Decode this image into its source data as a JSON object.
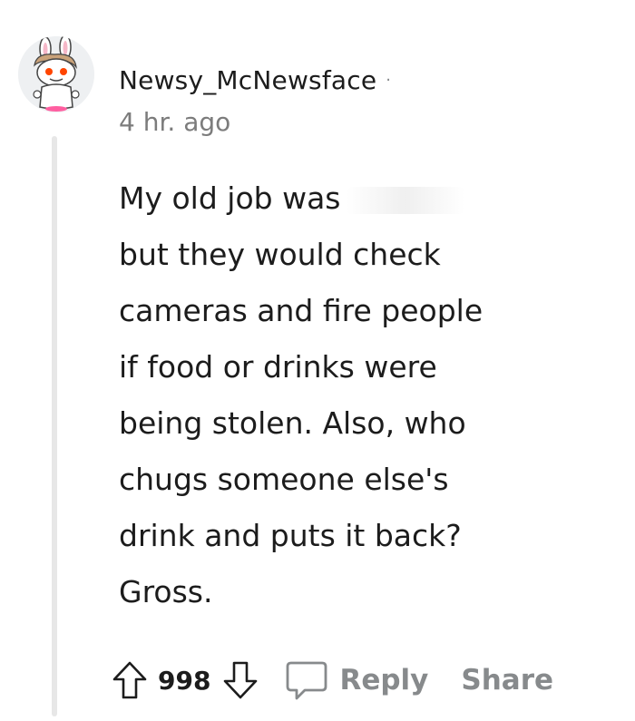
{
  "comment": {
    "author": "Newsy_McNewsface",
    "separator": "·",
    "timestamp": "4 hr. ago",
    "body_lines": [
      "My old job was",
      "but they would check",
      "cameras and fire people",
      "if food or drinks were",
      "being stolen. Also, who",
      "chugs someone else's",
      "drink and puts it back?",
      "Gross."
    ]
  },
  "actions": {
    "score": "998",
    "reply_label": "Reply",
    "share_label": "Share"
  },
  "colors": {
    "text": "#1c1c1c",
    "meta": "#7c7c7c",
    "action_gray": "#878a8c",
    "thread_line": "#e7e7e7",
    "avatar_bg": "#eef0f2",
    "snoo_eye": "#ff4500"
  },
  "icons": {
    "avatar": "snoo-avatar",
    "upvote": "upvote-arrow-icon",
    "downvote": "downvote-arrow-icon",
    "reply": "speech-bubble-icon"
  }
}
